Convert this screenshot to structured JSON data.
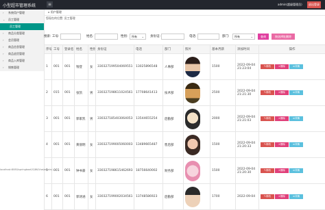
{
  "app": {
    "title": "小型超市管理系统",
    "admin_info": "admin(超级管理员)",
    "logout_label": "退出登录"
  },
  "sidebar": {
    "items": [
      {
        "label": "系统用户管理",
        "level": 0,
        "active": false
      },
      {
        "label": "员工管理",
        "level": 0,
        "active": false
      },
      {
        "label": "员工管理",
        "level": 1,
        "active": true
      },
      {
        "label": "商品分类管理",
        "level": 0,
        "active": false
      },
      {
        "label": "会员管理",
        "level": 0,
        "active": false
      },
      {
        "label": "商品信息管理",
        "level": 0,
        "active": false
      },
      {
        "label": "商品退货管理",
        "level": 0,
        "active": false
      },
      {
        "label": "商品入库管理",
        "level": 0,
        "active": false
      },
      {
        "label": "销售管理",
        "level": 0,
        "active": false
      }
    ]
  },
  "tabs": [
    {
      "label": "用户管理"
    }
  ],
  "breadcrumb": "您现在的位置: 员工管理",
  "search": {
    "labels": {
      "name_label": "搜索:",
      "job_no": "工号:",
      "name": "姓名:",
      "gender": "性别:",
      "id_card": "身份证:",
      "phone": "电话:",
      "dept": "部门:"
    },
    "gender_select": "所有",
    "dept_select": "所有",
    "search_button": "查询",
    "batch_button": "按选择批删除"
  },
  "table": {
    "headers": [
      "序号",
      "工号",
      "登录名",
      "姓名",
      "性别",
      "身份证",
      "电话",
      "部门",
      "照片",
      "基本月薪",
      "添加时间",
      "操作"
    ],
    "rows": [
      {
        "index": "1",
        "job_no": "001",
        "login": "001",
        "name": "钱登",
        "gender": "女",
        "id_card": "330327199504069551",
        "phone": "13025896548",
        "dept": "人事部",
        "salary": "1500",
        "added": "2022-09-04 21:23:04"
      },
      {
        "index": "2",
        "job_no": "015",
        "login": "001",
        "name": "张凯",
        "gender": "男",
        "id_card": "330327198611024561",
        "phone": "17708641413",
        "dept": "技术部",
        "salary": "2500",
        "added": "2022-09-04 21:21:30"
      },
      {
        "index": "3",
        "job_no": "001",
        "login": "001",
        "name": "郭家凯",
        "gender": "男",
        "id_card": "330327185403064053",
        "phone": "13544655254",
        "dept": "后勤部",
        "salary": "2000",
        "added": "2022-09-04 21:21:03"
      },
      {
        "index": "4",
        "job_no": "001",
        "login": "001",
        "name": "黄丽明",
        "gender": "女",
        "id_card": "330327199005060003",
        "phone": "13489665487",
        "dept": "售后部",
        "salary": "1500",
        "added": "2022-09-04 21:20:33"
      },
      {
        "index": "5",
        "job_no": "001",
        "login": "001",
        "name": "钟书豪",
        "gender": "女",
        "id_card": "330327198615462693",
        "phone": "18756640002",
        "dept": "财务部",
        "salary": "1500",
        "added": "2022-09-04 21:20:30"
      },
      {
        "index": "6",
        "job_no": "001",
        "login": "001",
        "name": "郭诗涵",
        "gender": "女",
        "id_card": "330327199002034561",
        "phone": "13748586923",
        "dept": "后勤部",
        "salary": "1700",
        "added": "2022-09-04"
      }
    ],
    "op_labels": {
      "edit": "修改",
      "delete": "删除",
      "view": "详情"
    }
  },
  "statusbar": "localhost:8080/springboot2Q8K/Vue/admin/..."
}
